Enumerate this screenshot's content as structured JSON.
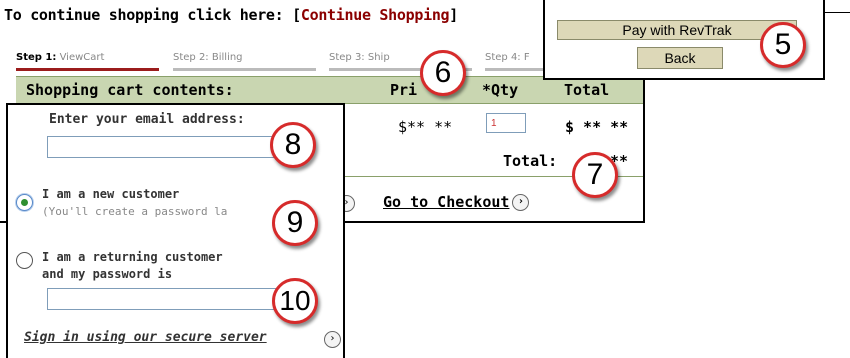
{
  "continue_bar": {
    "prefix": "To continue shopping click here: [",
    "link": "Continue Shopping",
    "suffix": "]"
  },
  "steps": [
    {
      "num": "Step 1:",
      "label": "ViewCart"
    },
    {
      "num": "Step 2:",
      "label": "Billing"
    },
    {
      "num": "Step 3:",
      "label": "Ship"
    },
    {
      "num": "Step 4:",
      "label": "F"
    }
  ],
  "cart_header": {
    "title": "Shopping cart contents:",
    "price": "Pri",
    "qty": "*Qty",
    "total": "Total"
  },
  "cart_row": {
    "price": "$** **",
    "qty": "1",
    "total": "$ ** **"
  },
  "total_label": "Total:",
  "total_value": "**",
  "checkout_link": "Go to Checkout",
  "pay": {
    "pay_button": "Pay with RevTrak",
    "back_button": "Back"
  },
  "email": {
    "label": "Enter your email address:",
    "new_customer": "I am a new customer",
    "new_customer_sub": "(You'll create a password la",
    "returning_customer": "I am a returning customer",
    "returning_customer_2": "and my password is",
    "signin_link": "Sign in using our secure server"
  },
  "callouts": [
    "5",
    "6",
    "7",
    "8",
    "9",
    "10"
  ],
  "icons": {
    "arrow": "chevron-right-circle-icon"
  },
  "colors": {
    "accent_red": "#d62b2b",
    "link_dark_red": "#8b0000",
    "header_green": "#c9d6b1",
    "button_tan": "#ddd8b8"
  }
}
